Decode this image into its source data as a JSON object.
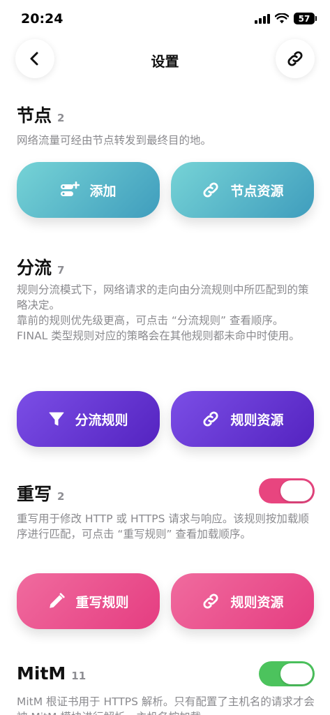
{
  "status": {
    "time": "20:24",
    "battery": "57"
  },
  "nav": {
    "title": "设置"
  },
  "sections": {
    "nodes": {
      "title": "节点",
      "count": "2",
      "desc": "网络流量可经由节点转发到最终目的地。",
      "buttons": [
        "添加",
        "节点资源"
      ]
    },
    "routing": {
      "title": "分流",
      "count": "7",
      "desc_lines": [
        "规则分流模式下，网络请求的走向由分流规则中所匹配到的策略决定。",
        "靠前的规则优先级更高，可点击 “分流规则” 查看顺序。",
        "FINAL 类型规则对应的策略会在其他规则都未命中时使用。"
      ],
      "buttons": [
        "分流规则",
        "规则资源"
      ]
    },
    "rewrite": {
      "title": "重写",
      "count": "2",
      "desc": "重写用于修改 HTTP 或 HTTPS 请求与响应。该规则按加载顺序进行匹配，可点击 “重写规则” 查看加载顺序。",
      "buttons": [
        "重写规则",
        "规则资源"
      ],
      "toggle_on": true
    },
    "mitm": {
      "title": "MitM",
      "count": "11",
      "desc": "MitM 根证书用于 HTTPS 解析。只有配置了主机名的请求才会被 MitM 模块进行解析，主机名按加载",
      "toggle_on": true
    }
  },
  "colors": {
    "teal": "#4fb0c8",
    "purple": "#6334d4",
    "pink": "#e84a86",
    "toggle_pink": "#e8457f",
    "toggle_green": "#4cc35d"
  },
  "icons": [
    "back-chevron-icon",
    "link-icon",
    "add-node-icon",
    "filter-icon",
    "pencil-icon"
  ]
}
